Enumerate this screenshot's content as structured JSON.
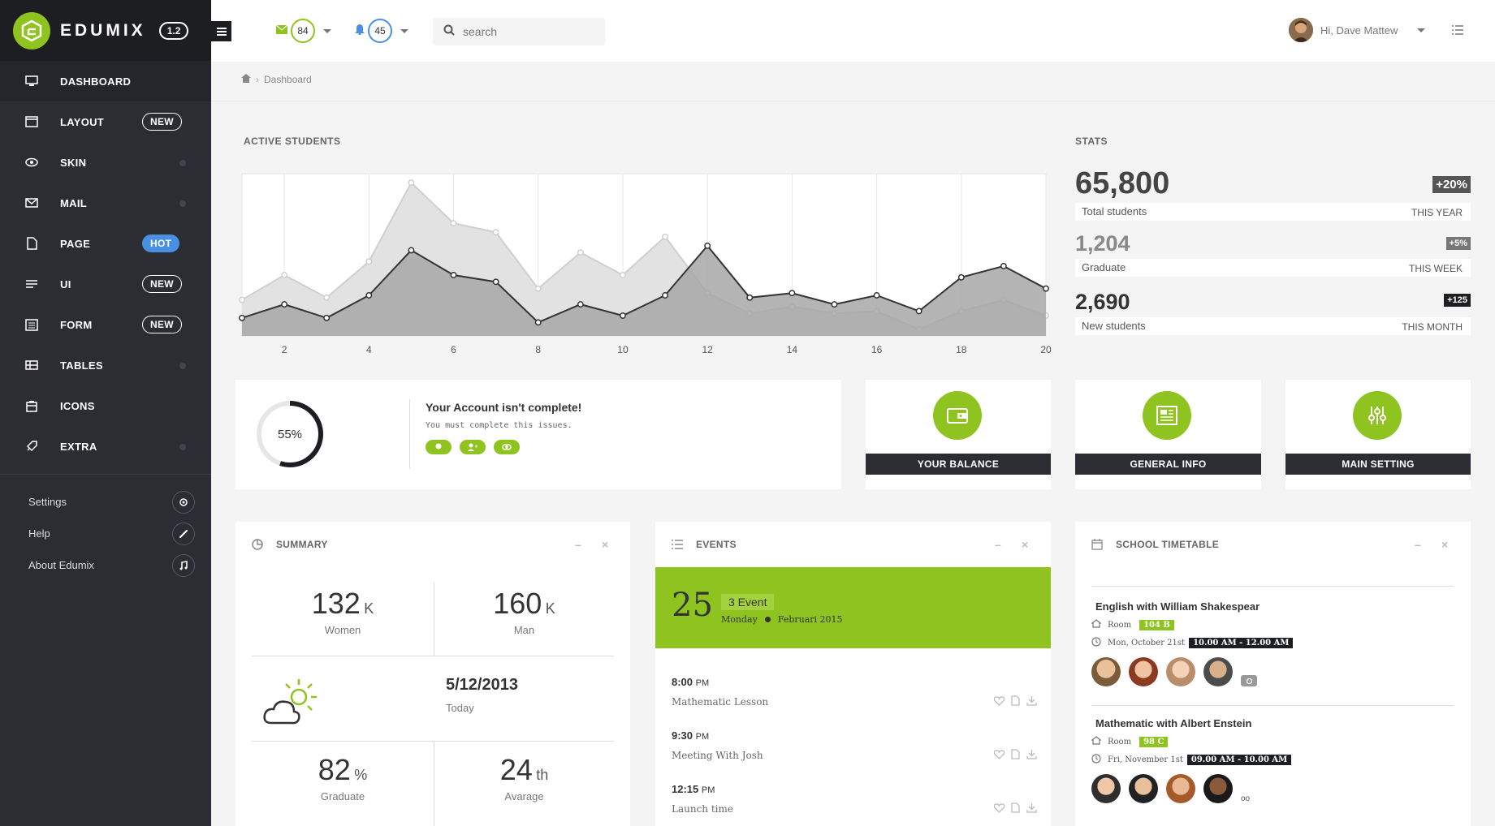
{
  "brand": {
    "name": "EDUMIX",
    "version": "1.2"
  },
  "sidebar": {
    "items": [
      {
        "label": "DASHBOARD",
        "icon": "monitor-icon",
        "badge": "",
        "active": true
      },
      {
        "label": "LAYOUT",
        "icon": "window-icon",
        "badge": "NEW"
      },
      {
        "label": "SKIN",
        "icon": "eye-icon",
        "badge": ""
      },
      {
        "label": "MAIL",
        "icon": "envelope-icon",
        "badge": ""
      },
      {
        "label": "PAGE",
        "icon": "file-icon",
        "badge": "HOT"
      },
      {
        "label": "UI",
        "icon": "lines-icon",
        "badge": "NEW"
      },
      {
        "label": "FORM",
        "icon": "form-icon",
        "badge": "NEW"
      },
      {
        "label": "TABLES",
        "icon": "table-icon",
        "badge": ""
      },
      {
        "label": "ICONS",
        "icon": "box-icon",
        "badge": ""
      },
      {
        "label": "EXTRA",
        "icon": "rocket-icon",
        "badge": ""
      }
    ],
    "links": [
      {
        "label": "Settings",
        "icon": "gear-icon"
      },
      {
        "label": "Help",
        "icon": "phone-icon"
      },
      {
        "label": "About  Edumix",
        "icon": "music-icon"
      }
    ]
  },
  "topbar": {
    "mail_count": "84",
    "notif_count": "45",
    "search_placeholder": "search",
    "user_greeting": "Hi, Dave Mattew"
  },
  "breadcrumb": {
    "current": "Dashboard"
  },
  "chart_title": "ACTIVE STUDENTS",
  "chart_data": {
    "type": "area",
    "x": [
      1,
      2,
      3,
      4,
      5,
      6,
      7,
      8,
      9,
      10,
      11,
      12,
      13,
      14,
      15,
      16,
      17,
      18,
      19,
      20
    ],
    "xticks": [
      "2",
      "4",
      "6",
      "8",
      "10",
      "12",
      "14",
      "16",
      "18",
      "20"
    ],
    "series": [
      {
        "values": [
          16,
          27,
          17,
          33,
          68,
          50,
          46,
          21,
          37,
          27,
          44,
          19,
          10,
          13,
          10,
          11,
          3,
          11,
          16,
          9
        ]
      },
      {
        "values": [
          8,
          14,
          8,
          18,
          38,
          27,
          24,
          6,
          14,
          9,
          18,
          40,
          17,
          19,
          14,
          18,
          11,
          26,
          31,
          21
        ]
      }
    ],
    "xlim": [
      1,
      20
    ],
    "ylim": [
      0,
      72
    ],
    "grid": true
  },
  "stats": {
    "title": "STATS",
    "items": [
      {
        "value": "65,800",
        "label": "Total students",
        "period": "THIS YEAR",
        "change": "+20%"
      },
      {
        "value": "1,204",
        "label": "Graduate",
        "period": "THIS WEEK",
        "change": "+5%"
      },
      {
        "value": "2,690",
        "label": "New students",
        "period": "THIS MONTH",
        "change": "+125"
      }
    ]
  },
  "account": {
    "progress_pct": 55,
    "progress_label": "55%",
    "title": "Your Account isn't complete!",
    "subtitle": "You must complete this issues."
  },
  "tiles": [
    {
      "label": "YOUR BALANCE",
      "icon": "wallet-icon"
    },
    {
      "label": "GENERAL INFO",
      "icon": "newspaper-icon"
    },
    {
      "label": "MAIN SETTING",
      "icon": "sliders-icon"
    }
  ],
  "summary": {
    "title": "SUMMARY",
    "women": {
      "value": "132",
      "unit": "K",
      "label": "Women"
    },
    "man": {
      "value": "160",
      "unit": "K",
      "label": "Man"
    },
    "date": "5/12/2013",
    "date_label": "Today",
    "graduate": {
      "value": "82",
      "unit": "%",
      "label": "Graduate"
    },
    "average": {
      "value": "24",
      "unit": "th",
      "label": "Avarage"
    }
  },
  "events": {
    "title": "EVENTS",
    "day": "25",
    "count_label": "3 Event",
    "weekday": "Monday",
    "month_year": "Februari 2015",
    "items": [
      {
        "time": "8:00",
        "ampm": "PM",
        "title": "Mathematic Lesson"
      },
      {
        "time": "9:30",
        "ampm": "PM",
        "title": "Meeting With Josh"
      },
      {
        "time": "12:15",
        "ampm": "PM",
        "title": "Launch time"
      }
    ]
  },
  "timetable": {
    "title": "SCHOOL TIMETABLE",
    "room_label": "Room",
    "items": [
      {
        "course": "English with William Shakespear",
        "room": "104 B",
        "date": "Mon, October 21st",
        "time": "10.00 AM - 12.00 AM"
      },
      {
        "course": "Mathematic with Albert Enstein",
        "room": "98 C",
        "date": "Fri, November 1st",
        "time": "09.00 AM - 10.00 AM"
      }
    ]
  },
  "colors": {
    "accent": "#8fc31f",
    "sidebar": "#2b2d33",
    "blue": "#4a90e2"
  }
}
